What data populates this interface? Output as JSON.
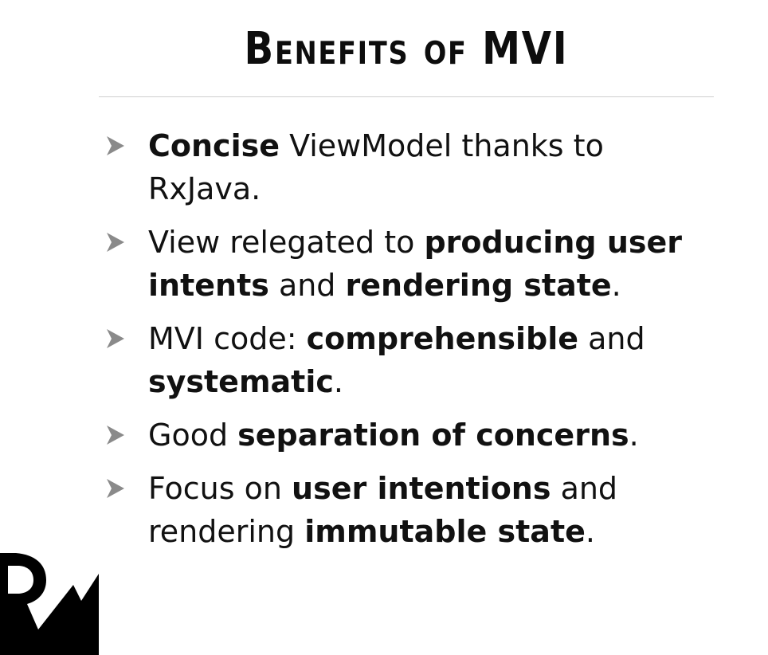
{
  "slide": {
    "title": "Benefits of MVI",
    "bullets": [
      {
        "segments": [
          {
            "text": "Concise",
            "bold": true
          },
          {
            "text": " ViewModel thanks to RxJava.",
            "bold": false
          }
        ]
      },
      {
        "segments": [
          {
            "text": "View relegated to ",
            "bold": false
          },
          {
            "text": "producing user intents",
            "bold": true
          },
          {
            "text": " and ",
            "bold": false
          },
          {
            "text": "rendering state",
            "bold": true
          },
          {
            "text": ".",
            "bold": false
          }
        ]
      },
      {
        "segments": [
          {
            "text": "MVI code: ",
            "bold": false
          },
          {
            "text": "comprehensible",
            "bold": true
          },
          {
            "text": " and ",
            "bold": false
          },
          {
            "text": "systematic",
            "bold": true
          },
          {
            "text": ".",
            "bold": false
          }
        ]
      },
      {
        "segments": [
          {
            "text": "Good ",
            "bold": false
          },
          {
            "text": "separation of concerns",
            "bold": true
          },
          {
            "text": ".",
            "bold": false
          }
        ]
      },
      {
        "segments": [
          {
            "text": "Focus on ",
            "bold": false
          },
          {
            "text": "user intentions",
            "bold": true
          },
          {
            "text": " and rendering ",
            "bold": false
          },
          {
            "text": "immutable state",
            "bold": true
          },
          {
            "text": ".",
            "bold": false
          }
        ]
      }
    ]
  },
  "icons": {
    "bullet_marker": "triangle-bullet-icon",
    "logo": "rw-logo-icon"
  },
  "colors": {
    "text": "#111111",
    "bullet_marker": "#8a8a8a",
    "divider": "#cfcfcf",
    "logo": "#000000"
  }
}
